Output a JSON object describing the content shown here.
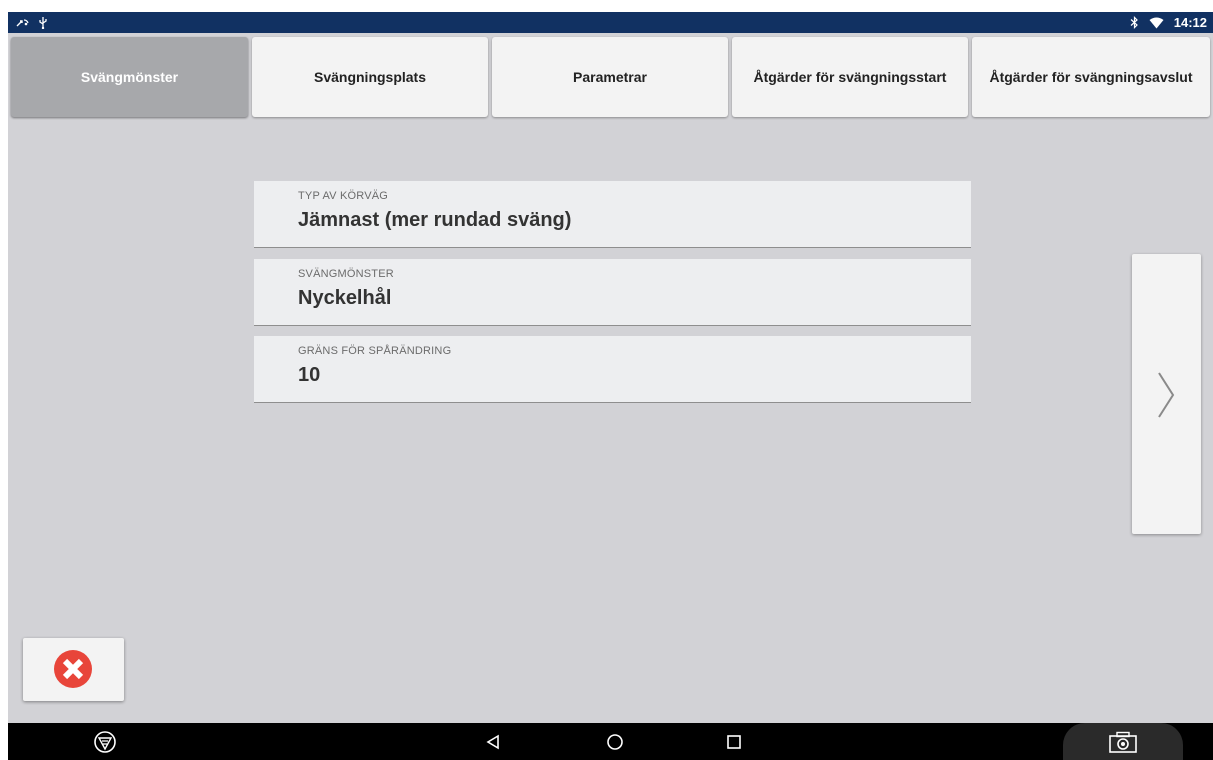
{
  "status_bar": {
    "left_icons": [
      "gps-antenna-icon",
      "usb-icon"
    ],
    "right_icons": [
      "bluetooth-icon",
      "wifi-icon"
    ],
    "time": "14:12",
    "background": "#113162"
  },
  "tabs": [
    {
      "label": "Svängmönster",
      "active": true
    },
    {
      "label": "Svängningsplats",
      "active": false
    },
    {
      "label": "Parametrar",
      "active": false
    },
    {
      "label": "Åtgärder för svängningsstart",
      "active": false
    },
    {
      "label": "Åtgärder för svängningsavslut",
      "active": false
    }
  ],
  "settings": [
    {
      "label": "TYP AV KÖRVÄG",
      "value": "Jämnast (mer rundad sväng)"
    },
    {
      "label": "SVÄNGMÖNSTER",
      "value": "Nyckelhål"
    },
    {
      "label": "GRÄNS FÖR SPÅRÄNDRING",
      "value": "10"
    }
  ],
  "next_button": {
    "icon": "chevron-right-icon"
  },
  "close_button": {
    "icon": "close-circle-icon",
    "color": "#e8453a"
  },
  "nav_bar": {
    "items": [
      "vehicle-logo-icon",
      "back-icon",
      "home-icon",
      "recents-icon",
      "camera-icon"
    ]
  },
  "colors": {
    "background": "#d2d2d6",
    "tab_active": "#a7a8ab",
    "tab_inactive": "#f3f3f3",
    "row_background": "#edeef0"
  }
}
